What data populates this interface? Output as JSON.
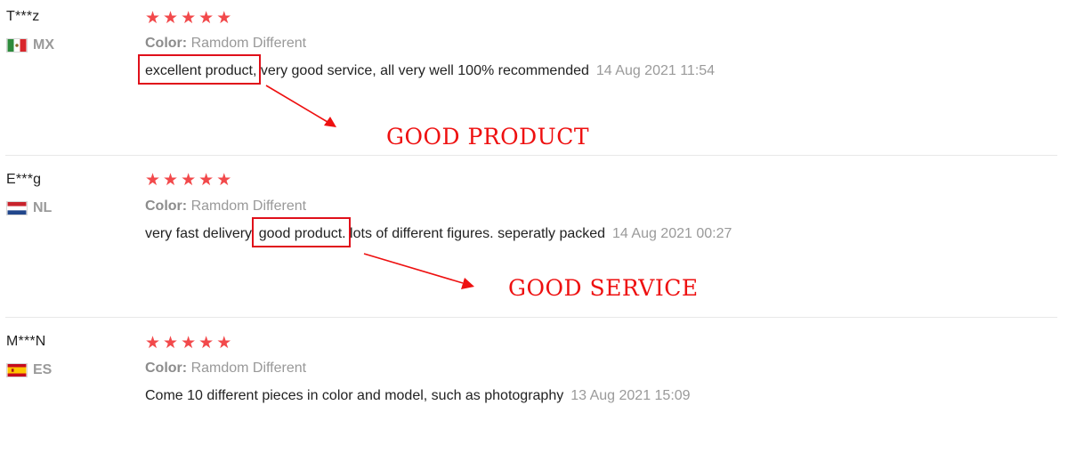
{
  "reviews": [
    {
      "name": "T***z",
      "country": "MX",
      "color_label": "Color:",
      "color_value": "Ramdom Different",
      "rating": 5,
      "highlight": "excellent product,",
      "text_rest": " very good service, all very well 100% recommended",
      "date": "14 Aug 2021 11:54"
    },
    {
      "name": "E***g",
      "country": "NL",
      "color_label": "Color:",
      "color_value": "Ramdom Different",
      "rating": 5,
      "text_pre": "very fast delivery, ",
      "highlight": "good product.",
      "text_rest": " lots of different figures. seperatly packed",
      "date": "14 Aug 2021 00:27"
    },
    {
      "name": "M***N",
      "country": "ES",
      "color_label": "Color:",
      "color_value": "Ramdom Different",
      "rating": 5,
      "text": "Come 10 different pieces in color and model, such as photography",
      "date": "13 Aug 2021 15:09"
    }
  ],
  "annotations": {
    "first": "GOOD PRODUCT",
    "second": "GOOD SERVICE"
  },
  "colors": {
    "star": "#f2494b",
    "annotation": "#ee1010",
    "muted_text": "#999999"
  },
  "icons": {
    "star": "star-icon",
    "flag_mx": "mexico-flag-icon",
    "flag_nl": "netherlands-flag-icon",
    "flag_es": "spain-flag-icon"
  }
}
